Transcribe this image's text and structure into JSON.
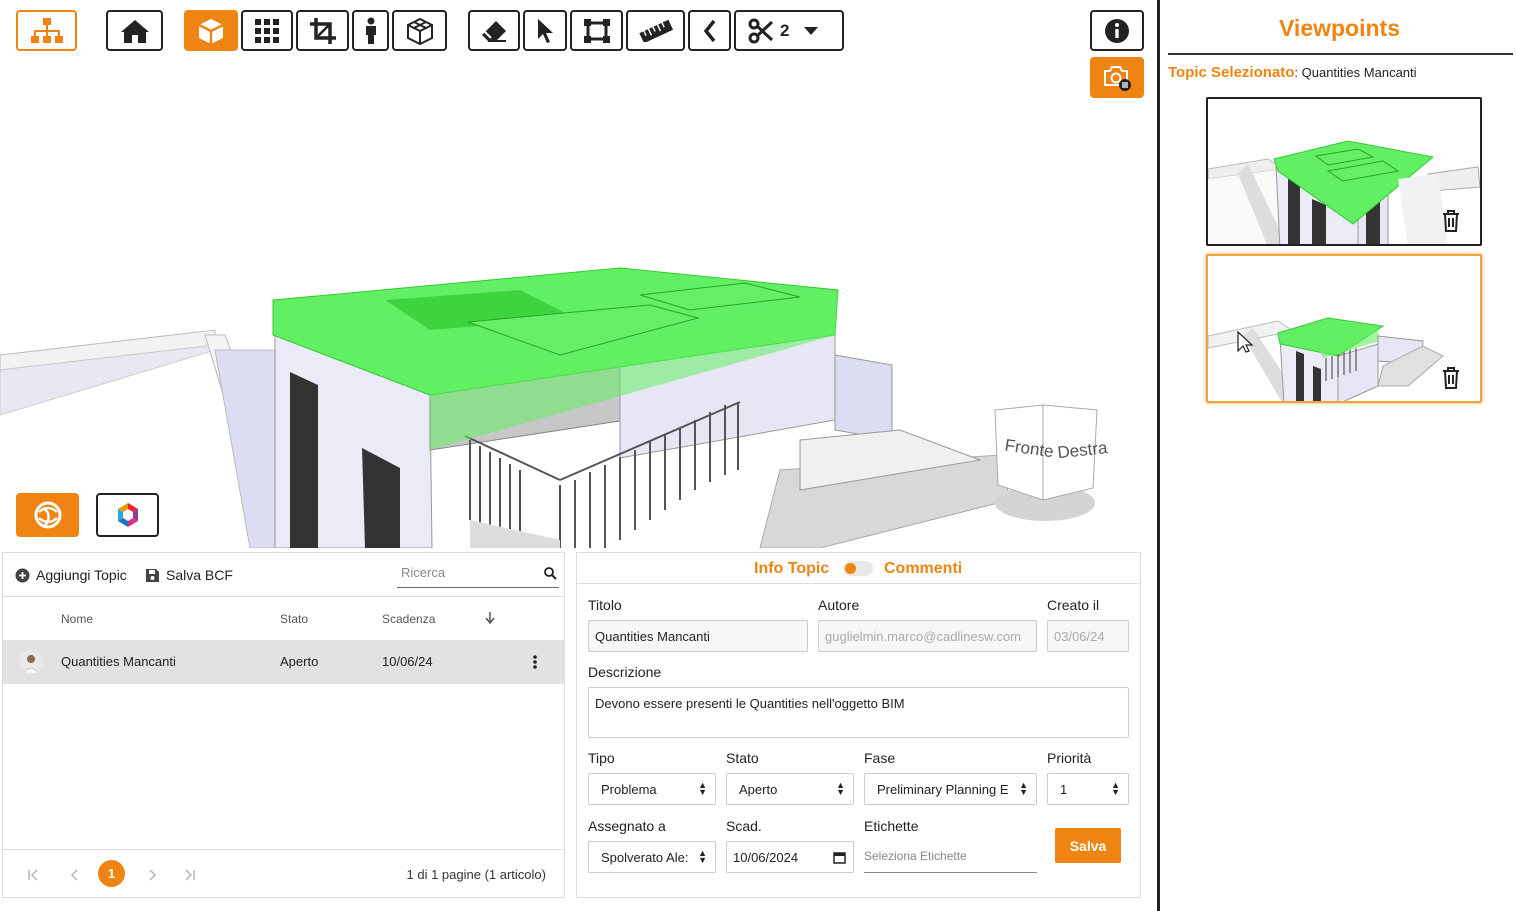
{
  "viewer": {
    "toolbar_icons": [
      "sitemap-icon",
      "home-icon",
      "cube-icon",
      "grid-icon",
      "crop-icon",
      "person-icon",
      "box-outline-icon",
      "eraser-icon",
      "cursor-icon",
      "section-box-icon",
      "ruler-icon",
      "chevron-left-icon",
      "scissors-icon",
      "caret-down-icon",
      "info-icon",
      "camera-list-icon"
    ],
    "cut_count": "2",
    "viewcube": {
      "front": "Fronte",
      "right": "Destra"
    }
  },
  "sidebar": {
    "title": "Viewpoints",
    "topic_label": "Topic Selezionato",
    "topic_value": ": Quantities Mancanti"
  },
  "list": {
    "add_label": "Aggiungi Topic",
    "save_bcf_label": "Salva BCF",
    "search_placeholder": "Ricerca",
    "columns": {
      "name": "Nome",
      "status": "Stato",
      "due": "Scadenza"
    },
    "rows": [
      {
        "name": "Quantities Mancanti",
        "status": "Aperto",
        "due": "10/06/24"
      }
    ],
    "pager": {
      "current": "1",
      "info": "1 di 1 pagine (1 articolo)"
    }
  },
  "form": {
    "tab_info": "Info Topic",
    "tab_comments": "Commenti",
    "title_label": "Titolo",
    "title_value": "Quantities Mancanti",
    "author_label": "Autore",
    "author_value": "guglielmin.marco@cadlinesw.com",
    "created_label": "Creato il",
    "created_value": "03/06/24",
    "desc_label": "Descrizione",
    "desc_value": "Devono essere presenti le Quantities nell'oggetto BIM",
    "type_label": "Tipo",
    "type_value": "Problema",
    "status_label": "Stato",
    "status_value": "Aperto",
    "phase_label": "Fase",
    "phase_value": "Preliminary Planning E",
    "priority_label": "Priorità",
    "priority_value": "1",
    "assigned_label": "Assegnato a",
    "assigned_value": "Spolverato Ale:",
    "due_label": "Scad.",
    "due_value": "10/06/2024",
    "tags_label": "Etichette",
    "tags_placeholder": "Seleziona Etichette",
    "save_label": "Salva"
  },
  "colors": {
    "accent": "#ef8412",
    "highlight": "#63ef63"
  }
}
